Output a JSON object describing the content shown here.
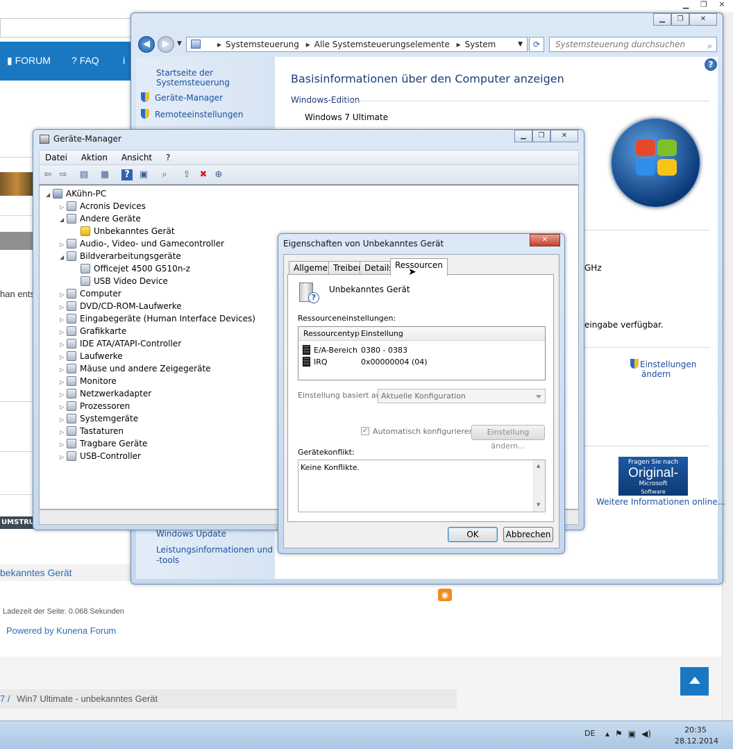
{
  "browser": {
    "nav": {
      "forum": "FORUM",
      "faq": "FAQ"
    },
    "snippet_text": "han ents",
    "dark_strip": "UMSTRUK",
    "breadcrumb_1": "bekanntes Gerät",
    "load_time": "Ladezeit der Seite: 0.068 Sekunden",
    "powered_by": "Powered by Kunena Forum",
    "breadcrumb_2": {
      "prefix": "7 /",
      "current": "Win7 Ultimate - unbekanntes Gerät"
    }
  },
  "system_window": {
    "address": [
      "Systemsteuerung",
      "Alle Systemsteuerungselemente",
      "System"
    ],
    "search_placeholder": "Systemsteuerung durchsuchen",
    "sidebar": {
      "home": "Startseite der Systemsteuerung",
      "links": [
        "Geräte-Manager",
        "Remoteeinstellungen"
      ],
      "bottom_links": [
        "Windows Update",
        "Leistungsinformationen und",
        "-tools"
      ]
    },
    "heading": "Basisinformationen über den Computer anzeigen",
    "edition_label": "Windows-Edition",
    "edition_value": "Windows 7 Ultimate",
    "partial_ghz": "GHz",
    "partial_input": "eingabe verfügbar.",
    "settings_link": [
      "Einstellungen",
      "ändern"
    ],
    "genuine": {
      "line1": "Fragen Sie nach",
      "line2": "Original-",
      "line3": "Microsoft",
      "line4": "Software"
    },
    "more_info": "Weitere Informationen online..."
  },
  "device_manager": {
    "title": "Geräte-Manager",
    "menu": [
      "Datei",
      "Aktion",
      "Ansicht",
      "?"
    ],
    "tree": {
      "root": "AKühn-PC",
      "items": [
        {
          "label": "Acronis Devices",
          "level": 1,
          "expanded": false
        },
        {
          "label": "Andere Geräte",
          "level": 1,
          "expanded": true
        },
        {
          "label": "Unbekanntes Gerät",
          "level": 2,
          "warn": true
        },
        {
          "label": "Audio-, Video- und Gamecontroller",
          "level": 1,
          "expanded": false
        },
        {
          "label": "Bildverarbeitungsgeräte",
          "level": 1,
          "expanded": true
        },
        {
          "label": "Officejet 4500 G510n-z",
          "level": 2
        },
        {
          "label": "USB Video Device",
          "level": 2
        },
        {
          "label": "Computer",
          "level": 1,
          "expanded": false
        },
        {
          "label": "DVD/CD-ROM-Laufwerke",
          "level": 1,
          "expanded": false
        },
        {
          "label": "Eingabegeräte (Human Interface Devices)",
          "level": 1,
          "expanded": false
        },
        {
          "label": "Grafikkarte",
          "level": 1,
          "expanded": false
        },
        {
          "label": "IDE ATA/ATAPI-Controller",
          "level": 1,
          "expanded": false
        },
        {
          "label": "Laufwerke",
          "level": 1,
          "expanded": false
        },
        {
          "label": "Mäuse und andere Zeigegeräte",
          "level": 1,
          "expanded": false
        },
        {
          "label": "Monitore",
          "level": 1,
          "expanded": false
        },
        {
          "label": "Netzwerkadapter",
          "level": 1,
          "expanded": false
        },
        {
          "label": "Prozessoren",
          "level": 1,
          "expanded": false
        },
        {
          "label": "Systemgeräte",
          "level": 1,
          "expanded": false
        },
        {
          "label": "Tastaturen",
          "level": 1,
          "expanded": false
        },
        {
          "label": "Tragbare Geräte",
          "level": 1,
          "expanded": false
        },
        {
          "label": "USB-Controller",
          "level": 1,
          "expanded": false
        }
      ]
    }
  },
  "properties_dialog": {
    "title": "Eigenschaften von Unbekanntes Gerät",
    "tabs": [
      "Allgemein",
      "Treiber",
      "Details",
      "Ressourcen"
    ],
    "selected_tab": "Ressourcen",
    "device_name": "Unbekanntes Gerät",
    "resource_settings_label": "Ressourceneinstellungen:",
    "table_headers": [
      "Ressourcentyp",
      "Einstellung"
    ],
    "rows": [
      {
        "type": "E/A-Bereich",
        "value": "0380 - 0383"
      },
      {
        "type": "IRQ",
        "value": "0x00000004 (04)"
      }
    ],
    "based_on_label": "Einstellung basiert auf:",
    "based_on_value": "Aktuelle Konfiguration",
    "auto_configure": "Automatisch konfigurieren",
    "change_setting": "Einstellung ändern...",
    "conflict_label": "Gerätekonflikt:",
    "conflict_text": "Keine Konflikte.",
    "ok": "OK",
    "cancel": "Abbrechen"
  },
  "taskbar": {
    "lang": "DE",
    "time": "20:35",
    "date": "28.12.2014"
  }
}
